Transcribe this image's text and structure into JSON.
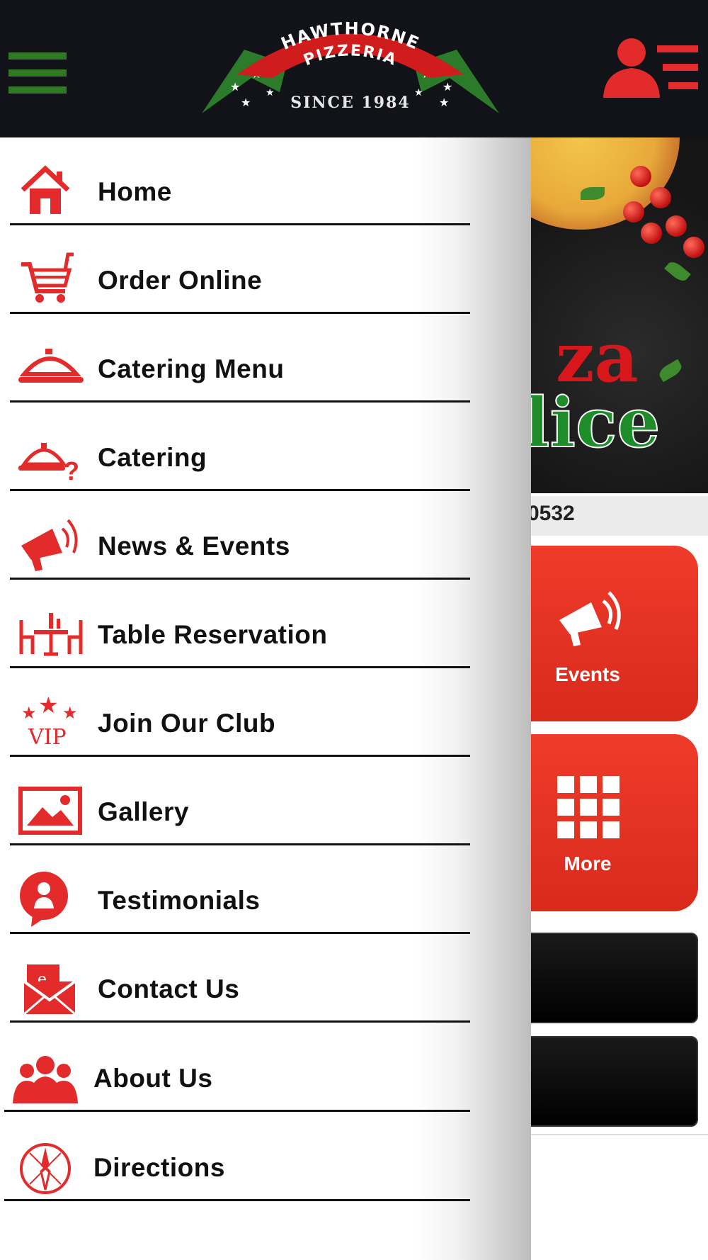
{
  "header": {
    "menu_icon": "hamburger-icon",
    "logo": {
      "line1": "HAWTHORNE",
      "line2": "PIZZERIA",
      "since": "SINCE 1984"
    },
    "profile_icon": "user-list-icon",
    "colors": {
      "bar": "#111318",
      "menu_icon": "#2f7a22",
      "accent": "#e42b2b"
    }
  },
  "drawer": {
    "items": [
      {
        "label": "Home",
        "icon": "home-icon"
      },
      {
        "label": "Order Online",
        "icon": "cart-icon"
      },
      {
        "label": "Catering Menu",
        "icon": "food-tray-icon"
      },
      {
        "label": "Catering",
        "icon": "food-tray-question-icon"
      },
      {
        "label": "News & Events",
        "icon": "megaphone-icon"
      },
      {
        "label": "Table Reservation",
        "icon": "table-icon"
      },
      {
        "label": "Join Our Club",
        "icon": "vip-icon"
      },
      {
        "label": "Gallery",
        "icon": "image-icon"
      },
      {
        "label": "Testimonials",
        "icon": "testimonial-icon"
      },
      {
        "label": "Contact Us",
        "icon": "email-icon"
      },
      {
        "label": "About Us",
        "icon": "people-icon"
      },
      {
        "label": "Directions",
        "icon": "compass-icon"
      }
    ]
  },
  "main": {
    "banner_text": {
      "line1": "za",
      "line2": "lice"
    },
    "phone_fragment": "0532",
    "tiles": [
      {
        "label": "Events",
        "icon": "megaphone-icon"
      },
      {
        "label": "More",
        "icon": "grid-icon"
      }
    ]
  }
}
